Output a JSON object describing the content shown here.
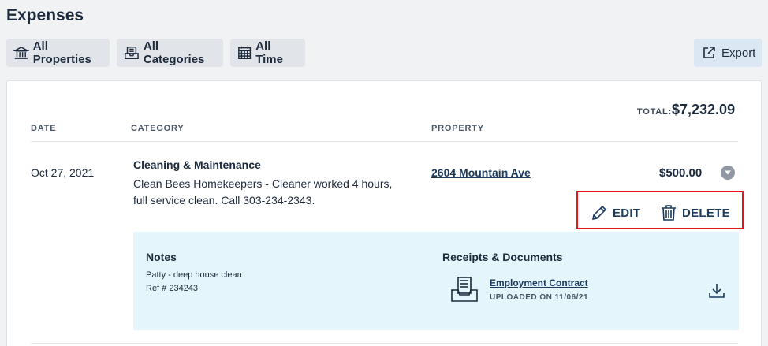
{
  "page": {
    "title": "Expenses"
  },
  "filters": [
    {
      "label": "All Properties",
      "icon": "building-icon"
    },
    {
      "label": "All Categories",
      "icon": "inbox-tray-icon"
    },
    {
      "label": "All Time",
      "icon": "calendar-icon"
    }
  ],
  "export": {
    "label": "Export",
    "icon": "external-link-icon"
  },
  "summary": {
    "total_label": "TOTAL:",
    "total_value": "$7,232.09"
  },
  "table": {
    "columns": {
      "date": "DATE",
      "category": "CATEGORY",
      "property": "PROPERTY"
    },
    "rows": [
      {
        "date": "Oct 27, 2021",
        "category": "Cleaning & Maintenance",
        "description": "Clean Bees Homekeepers - Cleaner worked 4 hours, full service clean. Call 303-234-2343.",
        "property": "2604 Mountain Ave",
        "amount": "$500.00",
        "actions": {
          "edit": "EDIT",
          "delete": "DELETE"
        },
        "details": {
          "notes_title": "Notes",
          "notes_lines": [
            "Patty - deep house clean",
            "Ref # 234243"
          ],
          "receipts_title": "Receipts & Documents",
          "document": {
            "name": "Employment Contract",
            "meta": "UPLOADED ON 11/06/21"
          }
        }
      }
    ]
  },
  "colors": {
    "highlight": "#e3161b",
    "details_bg": "#e4f5fb",
    "export_bg": "#dbe7f3",
    "filter_bg": "#e1e4e8"
  }
}
